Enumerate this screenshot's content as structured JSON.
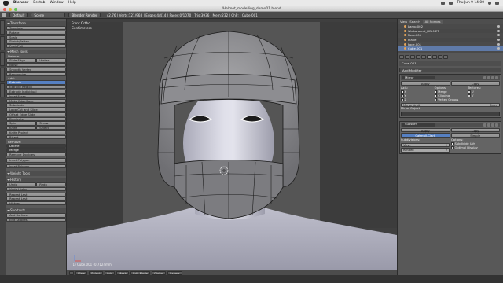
{
  "menubar": {
    "app": "Blender",
    "items": [
      "Blender",
      "Bestab",
      "Window",
      "Help"
    ],
    "clock": "Thu Jun 9  14:00"
  },
  "window": {
    "title": "/Helmet_modelling_demo01.blend"
  },
  "info_header": {
    "layout": "Default",
    "scene": "Scene",
    "engine": "Blender Render",
    "stats": "v2.76 | Verts:121/968 | Edges:4/414 | Faces:0/1070 | Tris:3936 | Mem:232 | ChP: | Cube.001"
  },
  "toolshelf": {
    "transform": {
      "title": "Transform",
      "buttons": [
        "Translate",
        "Rotate",
        "Scale",
        "Shrink/Fatten",
        "Push/Pull"
      ]
    },
    "mesh_tools": {
      "title": "Mesh Tools",
      "deform_label": "Deform:",
      "slide_edge": "Slide Edge",
      "vertex": "Vertex",
      "noise": "Noise",
      "smooth_vertex": "Smooth Vertex",
      "randomize": "Randomize",
      "add_label": "Add:",
      "add_buttons": [
        "Extrude",
        "Extrude Region",
        "Extrude Individual",
        "Inset Faces",
        "Make Edge/Face",
        "Subdivide",
        "Loop Cut and Slide",
        "Offset Edge Slide",
        "Duplicate"
      ],
      "spin": "Spin",
      "screw": "Screw",
      "knife": "Knife",
      "select": "Select",
      "knife_project": "Knife Project",
      "bisect": "Bisect",
      "remove_label": "Remove:",
      "delete": "Delete",
      "merge": "Merge",
      "remove_doubles": "Remove Doubles",
      "after": [
        "Inset Polygon",
        "Inset Polygon"
      ]
    },
    "weight_tools": {
      "title": "Weight Tools"
    },
    "history": {
      "title": "History",
      "undo": "Undo",
      "redo": "Redo",
      "buttons": [
        "Undo History",
        "Repeat Last",
        "Repeat Last",
        "History..."
      ]
    },
    "shortcuts": {
      "title": "Shortcuts",
      "buttons": [
        "Add Surface",
        "Edit Strokes"
      ]
    }
  },
  "viewport": {
    "view_label": "Front Ortho",
    "units_label": "Centimeters",
    "object_info": "(1) Cube.001 (0.7124mm)",
    "header": [
      "View",
      "Select",
      "Add",
      "Mesh",
      "Edit Mode",
      "Global",
      "Layers"
    ]
  },
  "outliner": {
    "view": "View",
    "search": "Search",
    "scene_filter": "All Scenes",
    "rows": [
      "Lamp.002",
      "Walkaround_HELMET",
      "Nerv.001",
      "Plane",
      "Face.001",
      "Cube.001"
    ]
  },
  "properties": {
    "breadcrumb": "Cube.001",
    "add_modifier": "Add Modifier",
    "mirror": {
      "name": "Mirror",
      "apply": "Apply",
      "copy": "Copy",
      "axis_label": "Axis:",
      "options_label": "Options:",
      "textures_label": "Textures:",
      "axes": [
        "X",
        "Y",
        "Z"
      ],
      "options": [
        "Merge",
        "Clipping",
        "Vertex Groups"
      ],
      "textures": [
        "U",
        "V"
      ],
      "merge_limit_label": "Merge Limit:",
      "merge_limit_value": "1mm",
      "mirror_object_label": "Mirror Object:"
    },
    "subsurf": {
      "name": "Subsurf",
      "apply": "Apply",
      "copy": "Copy",
      "catmull": "Catmull-Clark",
      "simple": "Simple",
      "subdivisions_label": "Subdivisions:",
      "options_label": "Options:",
      "view_label": "View:",
      "view_value": "2",
      "render_label": "Render:",
      "render_value": "2",
      "subdivide_uvs": "Subdivide UVs",
      "optimal_display": "Optimal Display"
    }
  },
  "colors": {
    "accent_blue": "#5680c2",
    "helmet_grey": "#8c8c8c",
    "face_skin": "#c9c9d4"
  }
}
